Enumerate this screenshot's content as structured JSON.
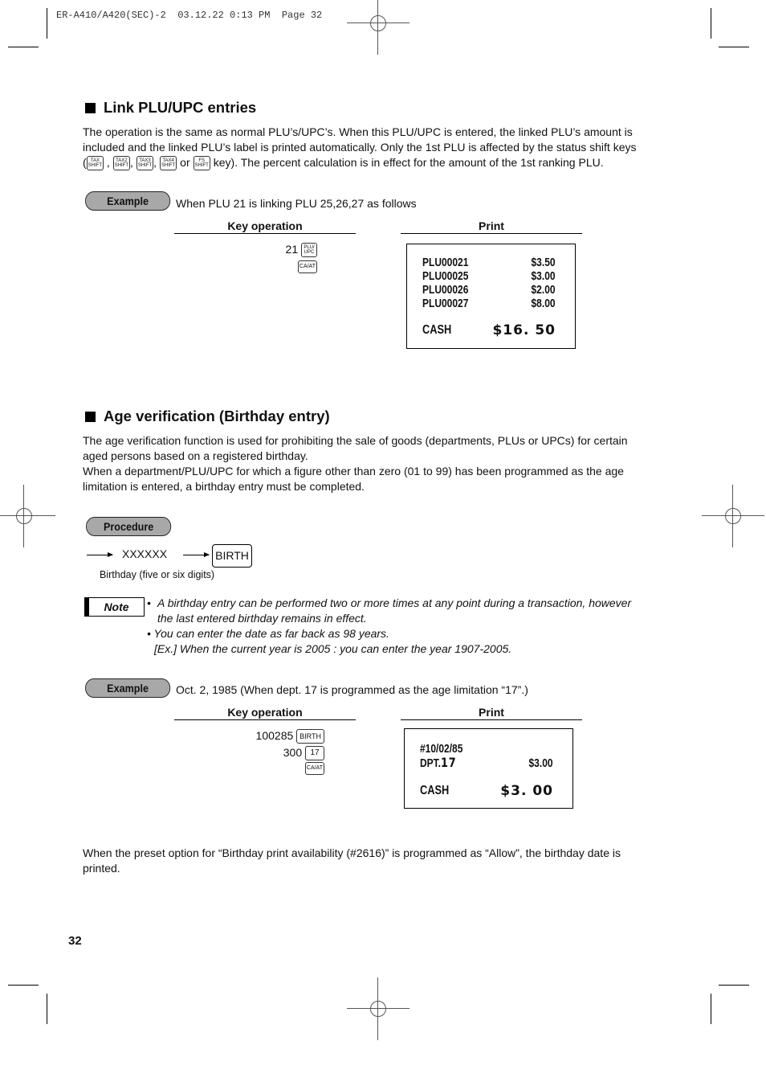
{
  "print_header": "ER-A410/A420(SEC)-2  03.12.22 0:13 PM  Page 32",
  "section1": {
    "title": "Link PLU/UPC entries",
    "para_line1": "The operation is the same as normal PLU’s/UPC’s. When this PLU/UPC is entered, the linked PLU’s amount is",
    "para_line2": "included and the linked PLU’s label is printed automatically. Only the 1st PLU is affected by the status shift keys",
    "para_line3_suffix": "key). The percent calculation is in effect for the amount of the 1st ranking PLU.",
    "keys": [
      {
        "top": "TAX",
        "bottom": "SHIFT"
      },
      {
        "top": "TAX2",
        "bottom": "SHIFT"
      },
      {
        "top": "TAX3",
        "bottom": "SHIFT"
      },
      {
        "top": "TAX4",
        "bottom": "SHIFT"
      },
      {
        "top": "FS",
        "bottom": "SHIFT"
      }
    ],
    "or_word": "or",
    "example_label": "Example",
    "example_text": "When PLU 21 is linking PLU 25,26,27 as follows",
    "key_op_header": "Key operation",
    "print_header": "Print",
    "key_ops": [
      {
        "prefix": "21",
        "key_top": "PLU/",
        "key_bottom": "UPC"
      },
      {
        "prefix": "",
        "key_top": "CA/AT",
        "key_bottom": ""
      }
    ],
    "receipt": {
      "lines": [
        {
          "label": "PLU00021",
          "amount": "$3.50"
        },
        {
          "label": "PLU00025",
          "amount": "$3.00"
        },
        {
          "label": "PLU00026",
          "amount": "$2.00"
        },
        {
          "label": "PLU00027",
          "amount": "$8.00"
        }
      ],
      "total_label": "CASH",
      "total_amount": "$16. 50"
    }
  },
  "section2": {
    "title": "Age verification (Birthday entry)",
    "para_line1": "The age verification function is used for prohibiting the sale of goods (departments, PLUs or UPCs) for certain",
    "para_line2": "aged persons based on a registered birthday.",
    "para_line3": "When a department/PLU/UPC for which a figure other than zero (01 to 99) has been programmed as the age",
    "para_line4": "limitation is entered, a birthday entry must be completed.",
    "procedure_label": "Procedure",
    "procedure_input": "XXXXXX",
    "procedure_key": "BIRTH",
    "procedure_caption": "Birthday (five or six digits)",
    "note_label": "Note",
    "note_items": [
      "A birthday entry can be performed two or more times at any point during a transaction, however",
      "the last entered birthday remains in effect.",
      "• You can enter the date as far back as 98 years.",
      "[Ex.]  When the current year is 2005 : you can enter the year 1907-2005."
    ],
    "example_label": "Example",
    "example_text": "Oct. 2, 1985 (When dept. 17 is programmed as the age limitation “17”.)",
    "key_op_header": "Key operation",
    "print_header": "Print",
    "key_ops": [
      {
        "prefix": "100285",
        "key": "BIRTH"
      },
      {
        "prefix": "300",
        "key": "17"
      },
      {
        "prefix": "",
        "key": "CA/AT"
      }
    ],
    "receipt": {
      "date_line": "#10/02/85",
      "dept_label": "DPT.",
      "dept_num": "17",
      "dept_amount": "$3.00",
      "total_label": "CASH",
      "total_amount": "$3. 00"
    },
    "footer_line1": "When the preset option for “Birthday print availability (#2616)” is programmed as “Allow”, the birthday date is",
    "footer_line2": "printed."
  },
  "page_number": "32"
}
